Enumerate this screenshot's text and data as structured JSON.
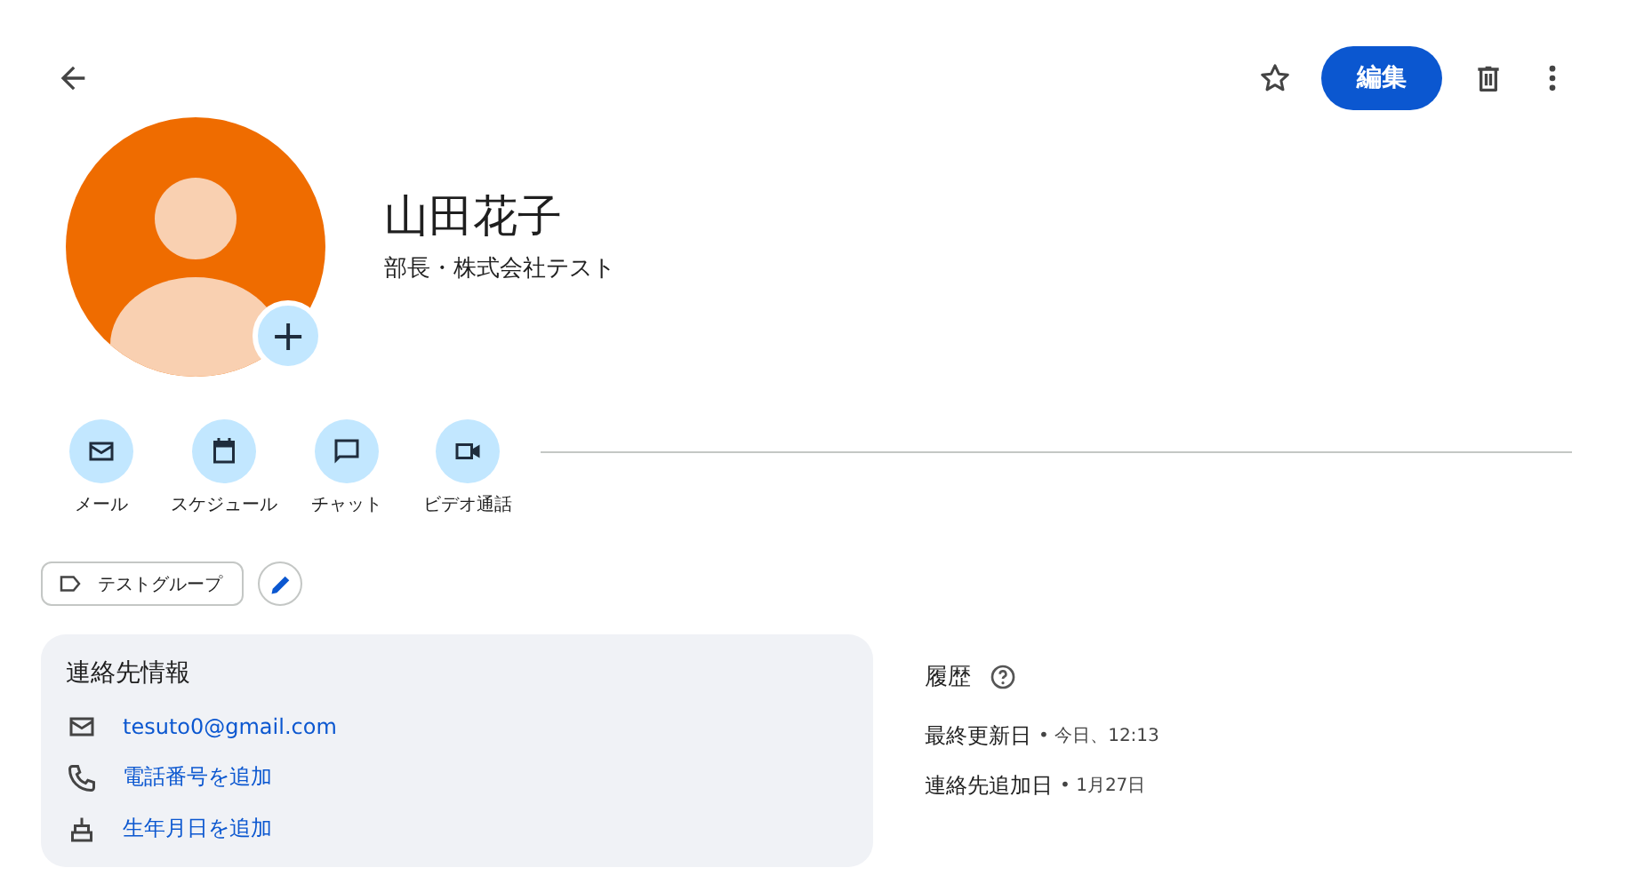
{
  "toolbar": {
    "starred": false,
    "edit_button": "編集"
  },
  "contact": {
    "name": "山田花子",
    "subtitle": "部長・株式会社テスト",
    "add_photo": "+"
  },
  "actions": [
    {
      "kind": "mail",
      "label": "メール"
    },
    {
      "kind": "calendar",
      "label": "スケジュール"
    },
    {
      "kind": "chat",
      "label": "チャット"
    },
    {
      "kind": "video",
      "label": "ビデオ通話"
    }
  ],
  "labels": [
    {
      "label": "テストグループ"
    }
  ],
  "contact_info": {
    "title": "連絡先情報",
    "rows": [
      {
        "kind": "mail",
        "text": "tesuto0@gmail.com"
      },
      {
        "kind": "phone",
        "text": "電話番号を追加"
      },
      {
        "kind": "birthday",
        "text": "生年月日を追加"
      }
    ]
  },
  "history": {
    "title": "履歴",
    "rows": [
      {
        "label": "最終更新日",
        "value": "• 今日、12:13"
      },
      {
        "label": "連絡先追加日",
        "value": "• 1月27日"
      }
    ]
  }
}
